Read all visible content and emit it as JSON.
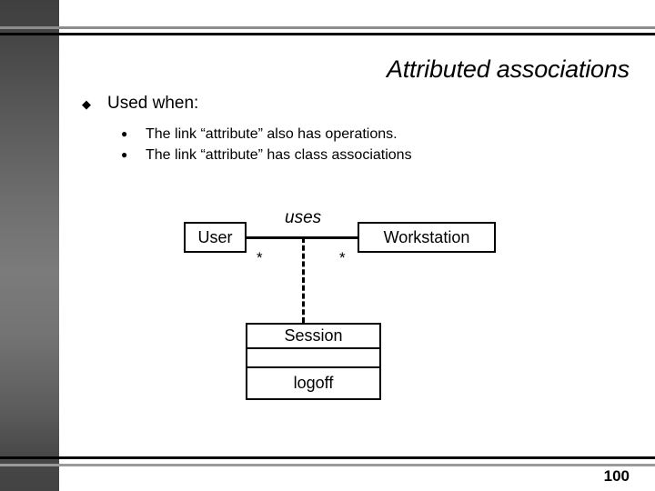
{
  "slide": {
    "title": "Attributed associations",
    "page_number": "100"
  },
  "body": {
    "level1": {
      "marker": "◆",
      "text": "Used when:"
    },
    "level2": [
      {
        "marker": "●",
        "text": "The link “attribute” also has operations."
      },
      {
        "marker": "●",
        "text": "The link “attribute” has class associations"
      }
    ]
  },
  "diagram": {
    "classes": {
      "user": {
        "name": "User"
      },
      "workstation": {
        "name": "Workstation"
      },
      "session": {
        "name": "Session",
        "attributes": "",
        "operations": "logoff"
      }
    },
    "association": {
      "label": "uses",
      "multiplicity_left": "*",
      "multiplicity_right": "*"
    }
  },
  "colors": {
    "sidebar_top": "#3f3f3f",
    "sidebar_mid": "#7b7b7b",
    "sidebar_bottom": "#434343",
    "rule_gray": "#8d8d8d",
    "rule_black": "#000000",
    "text": "#000000"
  }
}
